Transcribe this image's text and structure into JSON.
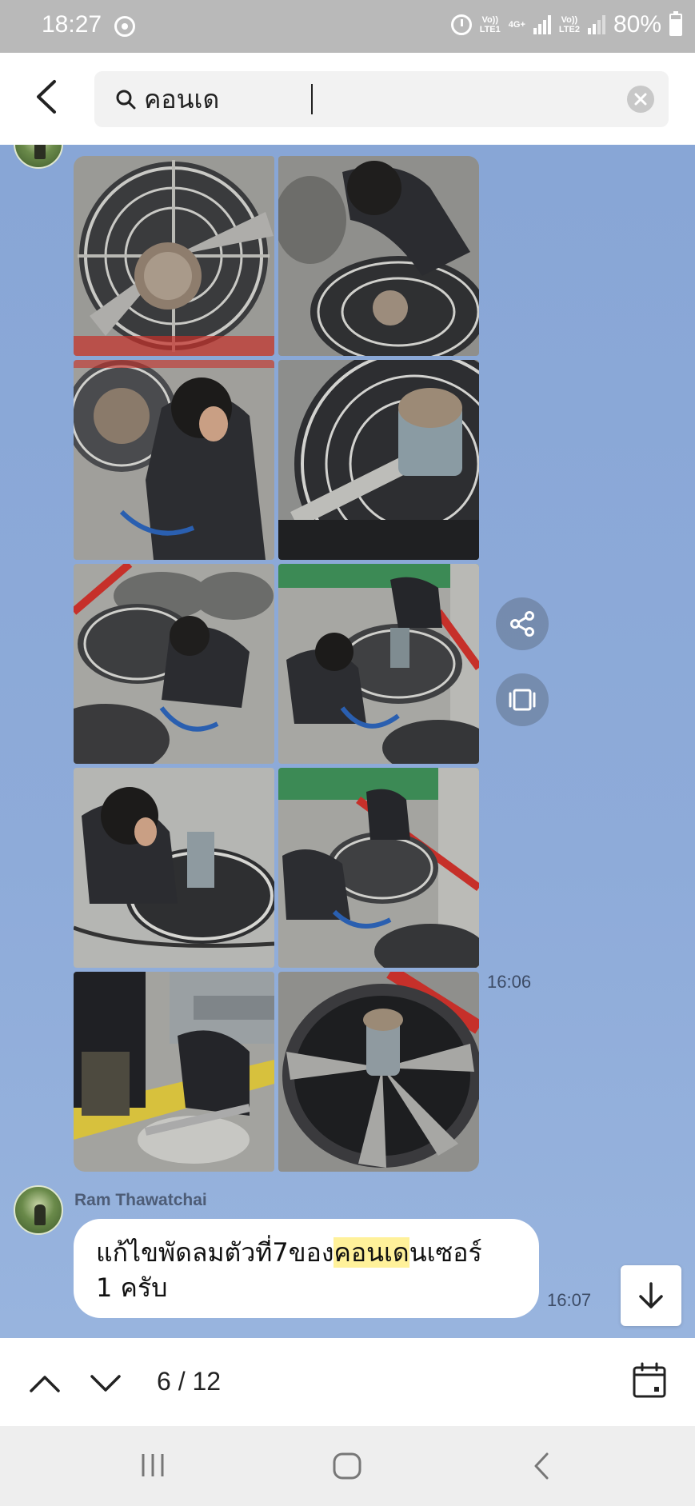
{
  "status_bar": {
    "time": "18:27",
    "sim1_label_top": "Vo))",
    "sim1_label_bottom": "LTE1",
    "network_type": "4G+",
    "sim2_label_top": "Vo))",
    "sim2_label_bottom": "LTE2",
    "battery": "80%"
  },
  "search": {
    "query": "คอนเด",
    "back_icon": "chevron-left-icon",
    "search_icon": "search-icon",
    "clear_icon": "close-icon"
  },
  "chat": {
    "photos": [
      {
        "label": "fan-closeup"
      },
      {
        "label": "worker-at-fan"
      },
      {
        "label": "worker-repairing"
      },
      {
        "label": "fan-motor"
      },
      {
        "label": "worker-roof"
      },
      {
        "label": "two-workers"
      },
      {
        "label": "worker-fan-housing"
      },
      {
        "label": "workers-roof-2"
      },
      {
        "label": "workers-blade"
      },
      {
        "label": "fan-interior"
      }
    ],
    "photos_time": "16:06",
    "share_icon": "share-icon",
    "gallery_icon": "gallery-icon",
    "message": {
      "sender": "Ram Thawatchai",
      "text_before": "แก้ไขพัดลมตัวที่7ของ",
      "text_highlight": "คอนเด",
      "text_after": "นเซอร์",
      "text_line2": "1 ครับ",
      "time": "16:07"
    },
    "scroll_down_icon": "arrow-down-icon"
  },
  "results_bar": {
    "count": "6 / 12",
    "prev_icon": "chevron-up-icon",
    "next_icon": "chevron-down-icon",
    "calendar_icon": "calendar-icon"
  },
  "colors": {
    "chat_background": "#8aa8d8",
    "highlight": "#fff19a"
  }
}
